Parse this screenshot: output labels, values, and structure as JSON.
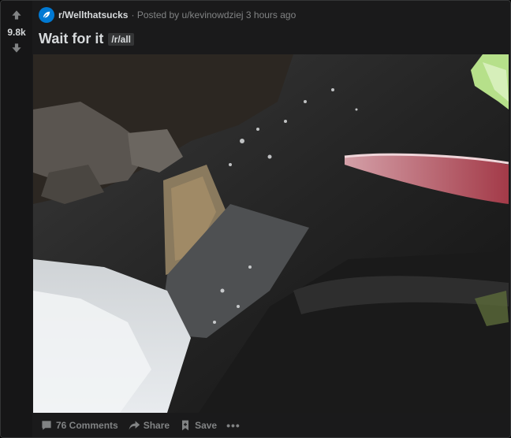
{
  "vote": {
    "score": "9.8k"
  },
  "meta": {
    "subreddit": "r/Wellthatsucks",
    "posted_by": "· Posted by u/kevinowdziej 3 hours ago"
  },
  "post": {
    "title": "Wait for it",
    "flair": "/r/all"
  },
  "actions": {
    "comments": "76 Comments",
    "share": "Share",
    "save": "Save",
    "more": "•••"
  },
  "colors": {
    "background": "#1a1a1b",
    "text": "#d7dadc",
    "muted": "#818384",
    "subreddit_icon": "#0079d3"
  },
  "media": {
    "icon": "video-frame"
  }
}
